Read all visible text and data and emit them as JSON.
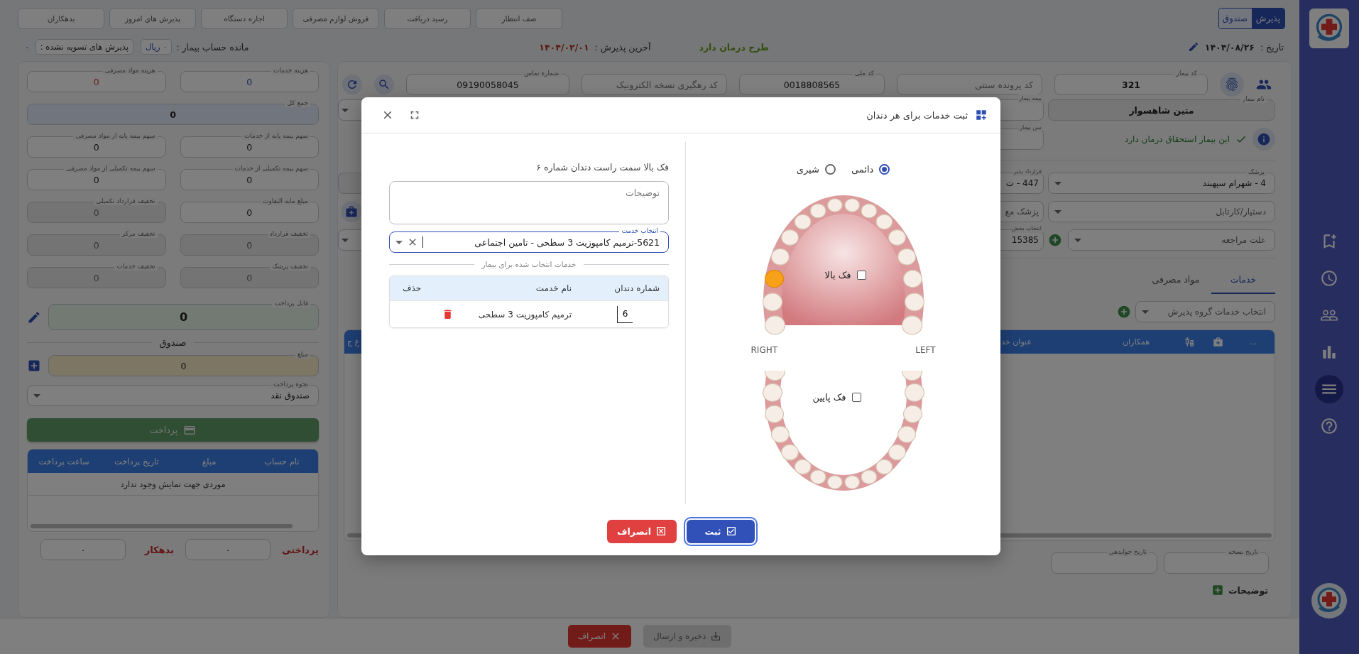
{
  "sidebar": {
    "items": [
      {
        "selected": false
      },
      {
        "selected": false
      },
      {
        "selected": false
      },
      {
        "selected": false
      },
      {
        "selected": true
      },
      {
        "selected": false
      }
    ]
  },
  "toolbar": {
    "mode_toggle": [
      {
        "label": "پذیرش",
        "selected": true
      },
      {
        "label": "صندوق",
        "selected": false
      }
    ],
    "buttons": [
      "صف انتظار",
      "رسید دریافت",
      "فروش لوازم مصرفی",
      "اجاره دستگاه",
      "پذیرش های امروز",
      "بدهکاران"
    ]
  },
  "info_bar": {
    "date_label": "تاریخ :",
    "date": "۱۴۰۴/۰۸/۲۶",
    "treatment_plan": "طرح درمان دارد",
    "last_admission_label": "آخرین پذیرش :",
    "last_admission": "۱۴۰۴/۰۲/۰۱",
    "balance_label": "مانده حساب بیمار :",
    "balance": "۰ ریال",
    "unsettled_label": "پذیرش های تسویه نشده :",
    "unsettled": "۰"
  },
  "patient": {
    "row1": [
      {
        "label": "کد بیمار",
        "value": "321"
      },
      {
        "placeholder": "کد پرونده سنتی"
      },
      {
        "label": "کد ملی",
        "value": "0018808565"
      },
      {
        "placeholder": "کد رهگیری نسخه الکترونیک"
      },
      {
        "label": "شماره تماس",
        "value": "09190058045"
      }
    ],
    "name": {
      "label": "نام بیمار",
      "value": "متین شاهسوار"
    },
    "eligibility": "این بیمار استحقاق درمان دارد",
    "doctor": {
      "label": "پزشک",
      "value": "4 - شهرام سپهبند"
    },
    "assistant": {
      "placeholder": "دستیار/کارتابل"
    },
    "reason": {
      "placeholder": "علت مراجعه"
    },
    "side_fields": [
      {
        "label": "بیمه بیمار"
      },
      {
        "label": "سن بیمار"
      },
      {
        "label": "قرارداد پذیر",
        "value": "447 - ت"
      },
      {
        "placeholder": "پزشک مع"
      },
      {
        "label": "انتخاب بخش",
        "value": "15385"
      }
    ]
  },
  "tabs": [
    {
      "label": "خدمات",
      "selected": true
    },
    {
      "label": "مواد مصرفی",
      "selected": false
    }
  ],
  "service_group": {
    "placeholder": "انتخاب خدمات گروه پذیرش"
  },
  "services_table": {
    "columns": [
      {
        "kind": "text",
        "label": "..."
      },
      {
        "kind": "icon"
      },
      {
        "kind": "icon"
      },
      {
        "kind": "text",
        "label": "همکاران"
      },
      {
        "kind": "text",
        "label": "عنوان خد"
      },
      {
        "kind": "text",
        "label": "غ ج"
      }
    ]
  },
  "dates": [
    {
      "label": "تاریخ نسخه"
    },
    {
      "label": "تاریخ جوابدهی"
    }
  ],
  "notes": {
    "label": "توضیحات"
  },
  "billing": {
    "fields": [
      {
        "label": "هزینه خدمات",
        "value": "0",
        "disabled": false,
        "kind": "primary"
      },
      {
        "label": "هزینه مواد مصرفی",
        "value": "0",
        "disabled": false,
        "kind": "danger"
      },
      {
        "label": "جمع کل",
        "value": "0",
        "disabled": false,
        "kind": "total"
      },
      {
        "label": "سهم بیمه پایه از خدمات",
        "value": "0",
        "disabled": false
      },
      {
        "label": "سهم بیمه پایه از مواد مصرفی",
        "value": "0",
        "disabled": false
      },
      {
        "label": "سهم بیمه تکمیلی از خدمات",
        "value": "0",
        "disabled": false
      },
      {
        "label": "سهم بیمه تکمیلی از مواد مصرفی",
        "value": "0",
        "disabled": false
      },
      {
        "label": "مبلغ مابه التفاوت",
        "value": "0",
        "disabled": false
      },
      {
        "label": "تخفیف قرارداد تکمیلی",
        "value": "0",
        "disabled": true
      },
      {
        "label": "تخفیف قرارداد",
        "value": "0",
        "disabled": true
      },
      {
        "label": "تخفیف مرکز",
        "value": "0",
        "disabled": true
      },
      {
        "label": "تخفیف پزشک",
        "value": "0",
        "disabled": true
      },
      {
        "label": "تخفیف خدمات",
        "value": "0",
        "disabled": true
      }
    ],
    "payable": {
      "label": "قابل پرداخت",
      "value": "0"
    }
  },
  "cashbox": {
    "title": "صندوق",
    "amount": {
      "label": "مبلغ",
      "value": "0"
    },
    "payment_method": {
      "label": "نحوه پرداخت",
      "value": "صندوق نقد"
    },
    "pay_button": "پرداخت",
    "table": {
      "columns": [
        "نام حساب",
        "مبلغ",
        "تاریخ پرداخت",
        "ساعت پرداخت"
      ],
      "empty": "موردی جهت نمایش وجود ندارد"
    },
    "totals": [
      {
        "label": "پرداختی",
        "value": "۰"
      },
      {
        "label": "بدهکار",
        "value": "۰"
      }
    ]
  },
  "footer": {
    "buttons": [
      {
        "label": "ذخیره و ارسال",
        "kind": "save",
        "disabled": true
      },
      {
        "label": "انصراف",
        "kind": "cancel",
        "disabled": false
      }
    ]
  },
  "modal": {
    "title": "ثبت خدمات برای هر دندان",
    "dentition": [
      {
        "label": "دائمی",
        "selected": true
      },
      {
        "label": "شیری",
        "selected": false
      }
    ],
    "upper_jaw": {
      "label": "فک بالا",
      "checked": false,
      "teeth": [
        {
          "selected": false
        },
        {
          "selected": false
        },
        {
          "selected": true
        },
        {
          "selected": false
        },
        {
          "selected": false
        },
        {
          "selected": false
        },
        {
          "selected": false
        },
        {
          "selected": false
        },
        {
          "selected": false
        },
        {
          "selected": false
        },
        {
          "selected": false
        },
        {
          "selected": false
        },
        {
          "selected": false
        },
        {
          "selected": false
        },
        {
          "selected": false
        },
        {
          "selected": false
        }
      ]
    },
    "side_labels": [
      "LEFT",
      "RIGHT"
    ],
    "lower_jaw": {
      "label": "فک پایین",
      "checked": false,
      "teeth": [
        {
          "selected": false
        },
        {
          "selected": false
        },
        {
          "selected": false
        },
        {
          "selected": false
        },
        {
          "selected": false
        },
        {
          "selected": false
        },
        {
          "selected": false
        },
        {
          "selected": false
        },
        {
          "selected": false
        },
        {
          "selected": false
        },
        {
          "selected": false
        },
        {
          "selected": false
        },
        {
          "selected": false
        },
        {
          "selected": false
        },
        {
          "selected": false
        },
        {
          "selected": false
        }
      ]
    },
    "tooth_caption": "فک بالا سمت راست دندان شماره ۶",
    "notes": {
      "placeholder": "توضیحات"
    },
    "service_select": {
      "label": "انتخاب خدمت",
      "value": "5621-ترمیم کامپوزیت 3 سطحی - تامین اجتماعی"
    },
    "selected_heading": "خدمات انتخاب شده برای بیمار",
    "table": {
      "columns": [
        "شماره دندان",
        "نام خدمت",
        "حذف"
      ],
      "rows": [
        {
          "tooth": "6",
          "service": "ترمیم کامپوزیت 3 سطحی"
        }
      ]
    },
    "buttons": [
      {
        "label": "ثبت",
        "kind": "submit"
      },
      {
        "label": "انصراف",
        "kind": "cancel"
      }
    ]
  }
}
